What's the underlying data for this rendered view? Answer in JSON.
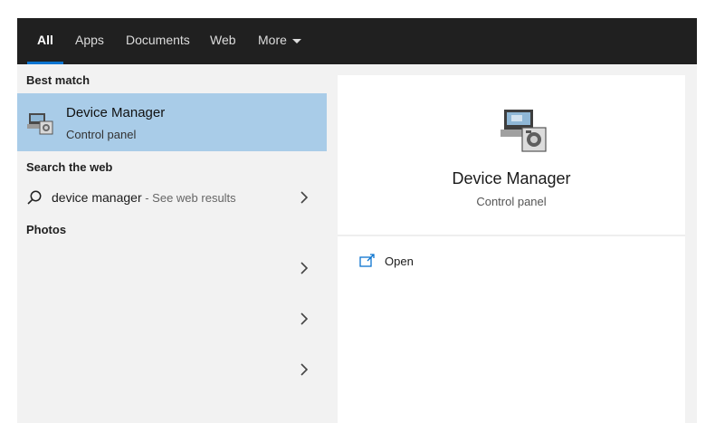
{
  "tabs": [
    {
      "label": "All",
      "active": true
    },
    {
      "label": "Apps"
    },
    {
      "label": "Documents"
    },
    {
      "label": "Web"
    },
    {
      "label": "More"
    }
  ],
  "left": {
    "best_match_heading": "Best match",
    "best_match": {
      "title": "Device Manager",
      "subtitle": "Control panel",
      "icon": "device-manager-icon"
    },
    "search_web_heading": "Search the web",
    "web_result": {
      "query": "device manager",
      "suffix": " - See web results",
      "icon": "search-icon"
    },
    "photos_heading": "Photos",
    "photo_rows": 3
  },
  "preview": {
    "title": "Device Manager",
    "subtitle": "Control panel",
    "icon": "device-manager-icon",
    "actions": [
      {
        "label": "Open",
        "icon": "open-icon"
      }
    ]
  },
  "colors": {
    "topbar": "#202020",
    "accent": "#0a74d0",
    "selection": "#a9cce8",
    "panel": "#f2f2f2"
  }
}
